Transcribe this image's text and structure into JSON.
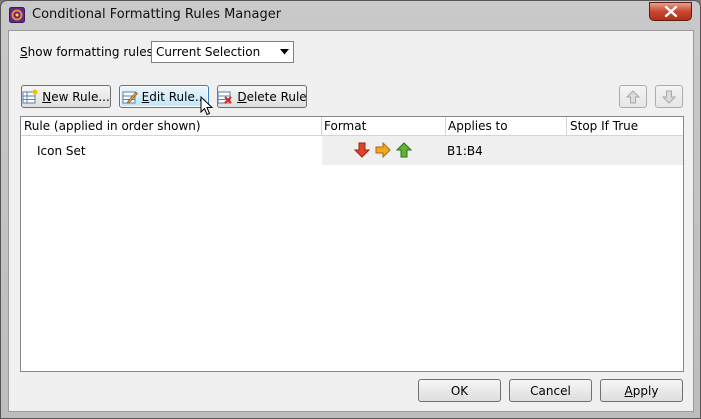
{
  "window": {
    "title": "Conditional Formatting Rules Manager",
    "app_icon": "app-icon",
    "close_icon": "close-icon"
  },
  "filter": {
    "label_accel": "S",
    "label_rest": "how formatting rules for:",
    "selected": "Current Selection"
  },
  "toolbar": {
    "new_rule": {
      "accel": "N",
      "rest": "ew Rule...",
      "icon": "new-rule-icon"
    },
    "edit_rule": {
      "accel": "E",
      "rest": "dit Rule...",
      "icon": "edit-rule-icon"
    },
    "delete_rule": {
      "accel": "D",
      "rest": "elete Rule",
      "icon": "delete-rule-icon"
    },
    "move_up_icon": "arrow-up-icon",
    "move_down_icon": "arrow-down-icon"
  },
  "table": {
    "columns": [
      "Rule (applied in order shown)",
      "Format",
      "Applies to",
      "Stop If True"
    ],
    "rows": [
      {
        "rule": "Icon Set",
        "format_icons": [
          "red-down-arrow-icon",
          "orange-right-arrow-icon",
          "green-up-arrow-icon"
        ],
        "applies_to": "B1:B4",
        "stop_if_true": ""
      }
    ]
  },
  "footer": {
    "ok": "OK",
    "cancel": "Cancel",
    "apply_accel": "A",
    "apply_rest": "pply"
  },
  "colors": {
    "red_arrow": "#e0442a",
    "orange_arrow": "#f5a623",
    "green_arrow": "#5fb336",
    "focus_border": "#3c7fb1"
  }
}
